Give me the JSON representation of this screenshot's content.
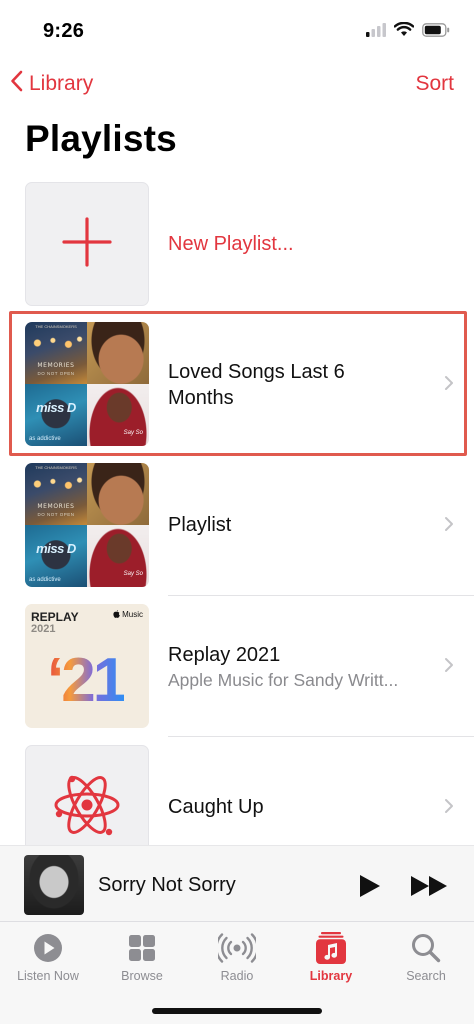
{
  "status_bar": {
    "time": "9:26"
  },
  "nav": {
    "back_label": "Library",
    "sort_label": "Sort"
  },
  "page_title": "Playlists",
  "rows": {
    "new_playlist": {
      "title": "New Playlist..."
    },
    "loved": {
      "title_line1": "Loved Songs Last 6",
      "title_line2": "Months"
    },
    "playlist": {
      "title": "Playlist"
    },
    "replay": {
      "title": "Replay 2021",
      "subtitle": "Apple Music for Sandy Writt...",
      "art_label": "REPLAY",
      "art_year": "2021",
      "art_badge": "Music",
      "art_big": "‘21"
    },
    "caught_up": {
      "title": "Caught Up"
    }
  },
  "album_art_text": {
    "memories_top": "THE CHAINSMOKERS",
    "memories_title": "MEMORIES",
    "memories_sub": "DO NOT OPEN",
    "missd_title": "miss D",
    "missd_caption": "as addictive",
    "doja_caption": "Say So"
  },
  "now_playing": {
    "title": "Sorry Not Sorry"
  },
  "tabs": [
    {
      "label": "Listen Now",
      "icon": "play-circle-icon"
    },
    {
      "label": "Browse",
      "icon": "grid-icon"
    },
    {
      "label": "Radio",
      "icon": "radio-waves-icon"
    },
    {
      "label": "Library",
      "icon": "library-music-icon"
    },
    {
      "label": "Search",
      "icon": "magnifier-icon"
    }
  ],
  "colors": {
    "accent": "#e2363f",
    "highlight_box": "#e05a4e",
    "tab_inactive": "#8d8d92"
  }
}
